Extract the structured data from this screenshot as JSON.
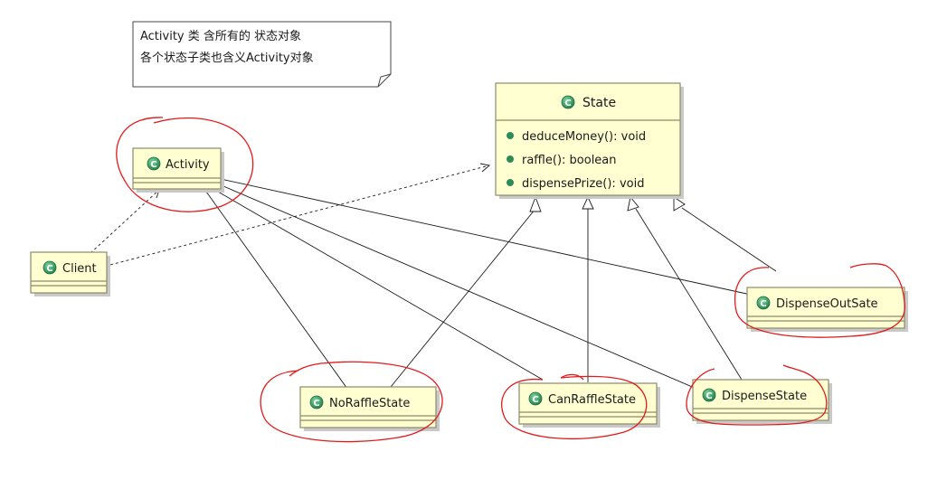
{
  "note": {
    "line1": "Activity 类 含所有的 状态对象",
    "line2": "各个状态子类也含义Activity对象"
  },
  "classes": {
    "state": {
      "name": "State",
      "methods": [
        "deduceMoney(): void",
        "raffle(): boolean",
        "dispensePrize(): void"
      ]
    },
    "activity": {
      "name": "Activity"
    },
    "client": {
      "name": "Client"
    },
    "no_raffle": {
      "name": "NoRaffleState"
    },
    "can_raffle": {
      "name": "CanRaffleState"
    },
    "dispense": {
      "name": "DispenseState"
    },
    "dispense_out": {
      "name": "DispenseOutSate"
    }
  },
  "colors": {
    "class_fill": "#ffffd1",
    "class_icon": "#2e8b57",
    "method_dot": "#2e8b57",
    "annotation_red": "#e01b1b"
  }
}
